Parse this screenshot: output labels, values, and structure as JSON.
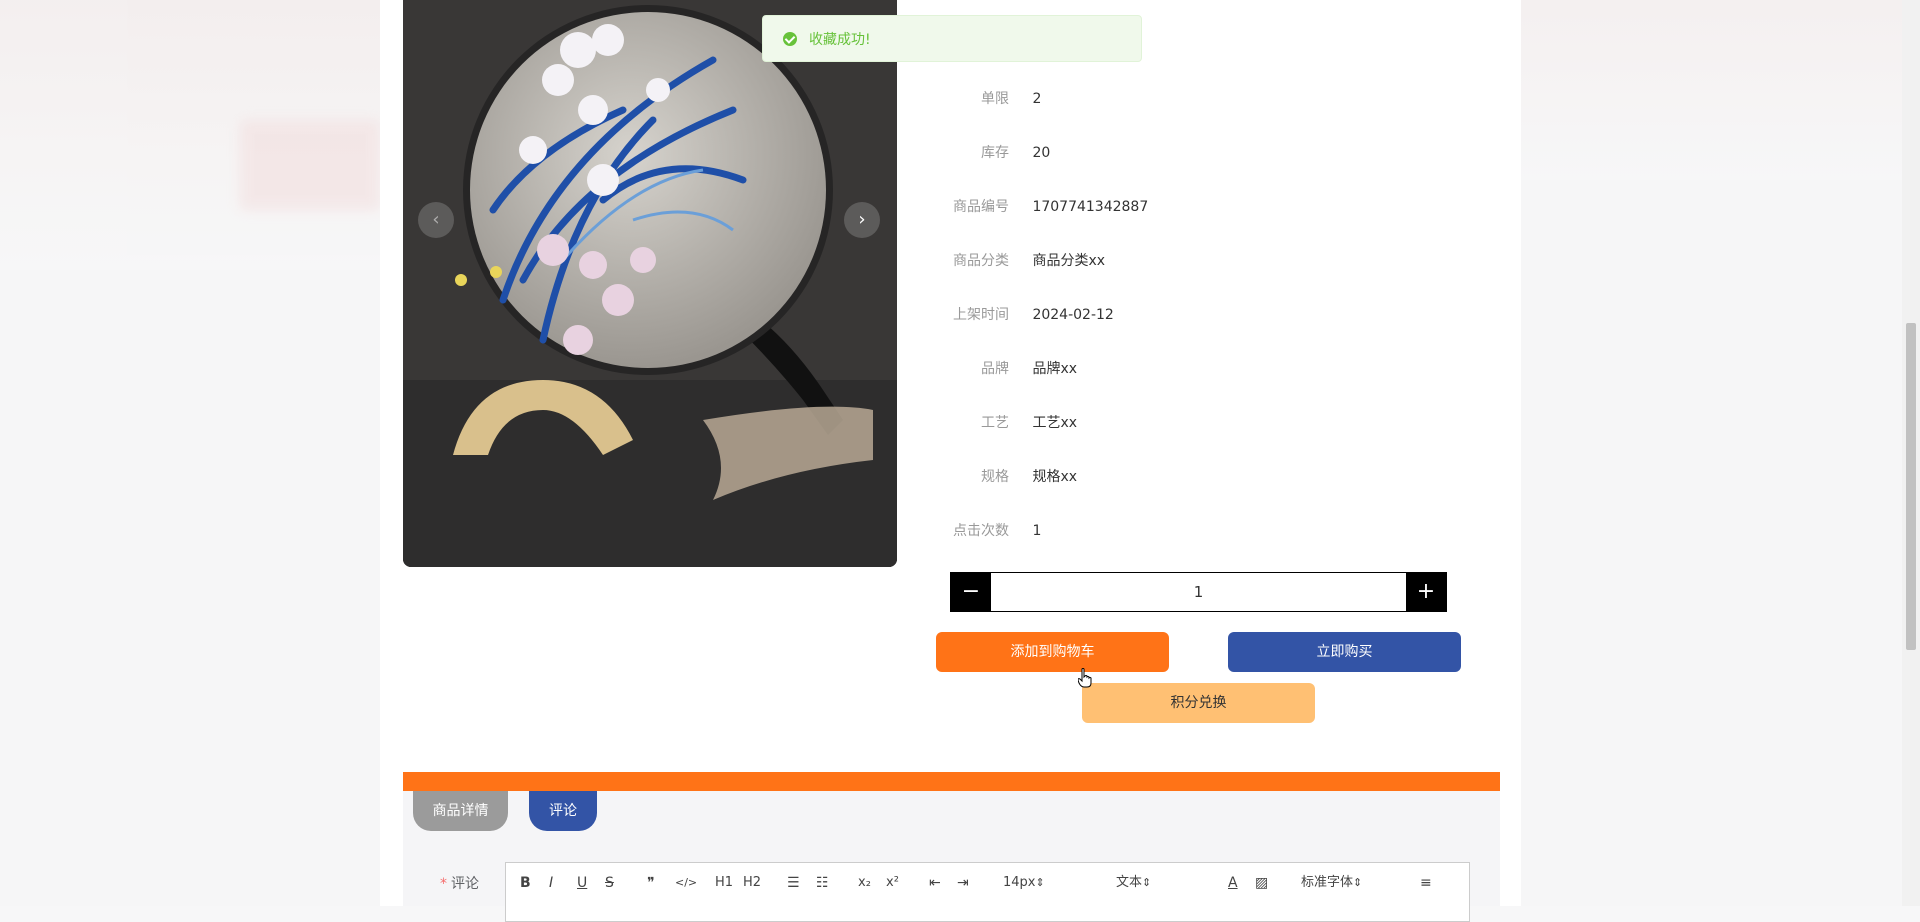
{
  "toast": {
    "message": "收藏成功!"
  },
  "product": {
    "info": [
      {
        "label": "单限",
        "value": "2"
      },
      {
        "label": "库存",
        "value": "20"
      },
      {
        "label": "商品编号",
        "value": "1707741342887"
      },
      {
        "label": "商品分类",
        "value": "商品分类xx"
      },
      {
        "label": "上架时间",
        "value": "2024-02-12"
      },
      {
        "label": "品牌",
        "value": "品牌xx"
      },
      {
        "label": "工艺",
        "value": "工艺xx"
      },
      {
        "label": "规格",
        "value": "规格xx"
      },
      {
        "label": "点击次数",
        "value": "1"
      }
    ],
    "quantity": "1",
    "quantity_minus": "−",
    "quantity_plus": "+"
  },
  "carousel": {
    "prev": "‹",
    "next": "›"
  },
  "actions": {
    "add_to_cart": "添加到购物车",
    "buy_now": "立即购买",
    "points_exchange": "积分兑换"
  },
  "tabs": {
    "detail": "商品详情",
    "comment": "评论"
  },
  "comment": {
    "required_mark": "*",
    "label": "评论",
    "toolbar": {
      "bold": "B",
      "italic": "I",
      "underline": "U",
      "strike": "S",
      "blockquote": "❞",
      "code": "</>",
      "h1": "H1",
      "h2": "H2",
      "ordered_list": "☰",
      "bullet_list": "☷",
      "subscript": "x₂",
      "superscript": "x²",
      "outdent": "⇤",
      "indent": "⇥",
      "size": "14px",
      "header": "文本",
      "font": "标准字体",
      "color": "A",
      "background": "▨",
      "align": "≡"
    }
  },
  "colors": {
    "orange": "#ff7317",
    "blue": "#3354a6",
    "light_orange": "#ffc073",
    "success": "#67c23a"
  }
}
